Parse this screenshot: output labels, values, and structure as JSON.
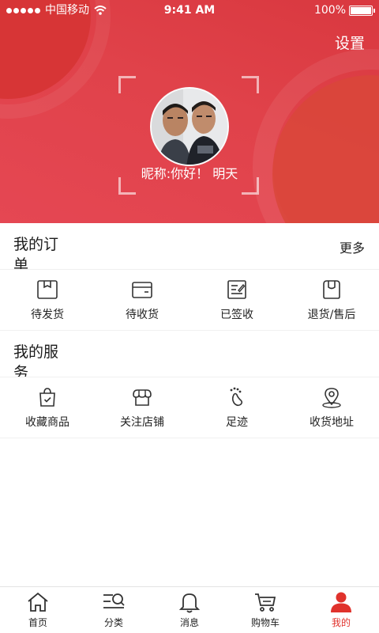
{
  "status_bar": {
    "carrier": "中国移动",
    "time": "9:41 AM",
    "battery": "100%",
    "battery_level": 1.0
  },
  "header": {
    "settings_label": "设置",
    "nickname": "昵称:你好！ 明天"
  },
  "orders": {
    "title": "我的订单",
    "more_label": "更多",
    "items": [
      {
        "label": "待发货",
        "icon": "box-icon"
      },
      {
        "label": "待收货",
        "icon": "wallet-icon"
      },
      {
        "label": "已签收",
        "icon": "signed-document-icon"
      },
      {
        "label": "退货/售后",
        "icon": "return-bag-icon"
      }
    ]
  },
  "services": {
    "title": "我的服务",
    "items": [
      {
        "label": "收藏商品",
        "icon": "favorite-bag-icon"
      },
      {
        "label": "关注店铺",
        "icon": "shop-icon"
      },
      {
        "label": "足迹",
        "icon": "footprint-icon"
      },
      {
        "label": "收货地址",
        "icon": "location-pin-icon"
      }
    ]
  },
  "tabbar": {
    "items": [
      {
        "label": "首页",
        "icon": "home-icon",
        "active": false
      },
      {
        "label": "分类",
        "icon": "category-search-icon",
        "active": false
      },
      {
        "label": "消息",
        "icon": "bell-icon",
        "active": false
      },
      {
        "label": "购物车",
        "icon": "cart-icon",
        "active": false
      },
      {
        "label": "我的",
        "icon": "user-icon",
        "active": true
      }
    ],
    "active_color": "#e0322c"
  },
  "colors": {
    "header_red": "#e0424a",
    "accent": "#e0322c"
  }
}
